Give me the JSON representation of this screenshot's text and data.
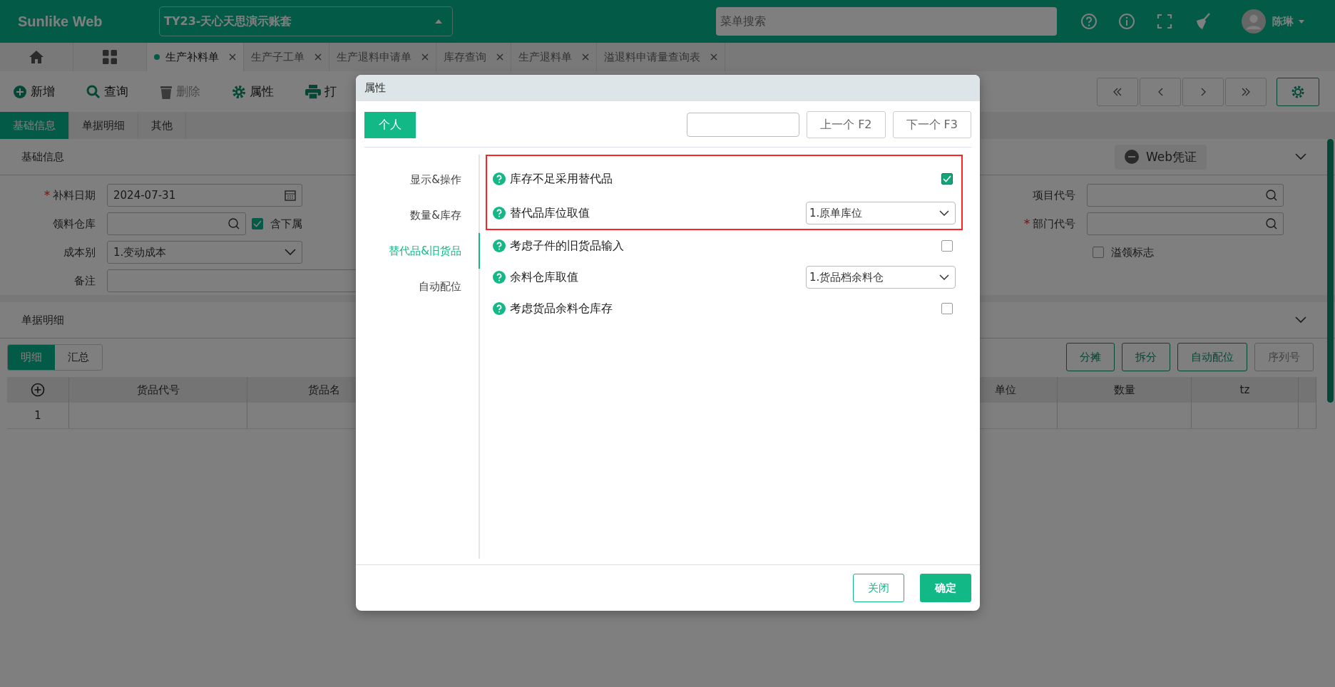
{
  "header": {
    "logo": "Sunlike Web",
    "account": "TY23-天心天思演示账套",
    "search_placeholder": "菜单搜索",
    "user": "陈琳"
  },
  "page_tabs": [
    {
      "label": "生产补料单",
      "selected": true
    },
    {
      "label": "生产子工单",
      "selected": false
    },
    {
      "label": "生产退料申请单",
      "selected": false
    },
    {
      "label": "库存查询",
      "selected": false
    },
    {
      "label": "生产退料单",
      "selected": false
    },
    {
      "label": "溢退料申请量查询表",
      "selected": false
    }
  ],
  "toolbar": [
    {
      "label": "新增",
      "kind": "add",
      "disabled": false
    },
    {
      "label": "查询",
      "kind": "search",
      "disabled": false
    },
    {
      "label": "删除",
      "kind": "delete",
      "disabled": true
    },
    {
      "label": "属性",
      "kind": "settings",
      "disabled": false
    },
    {
      "label": "打",
      "kind": "print",
      "disabled": false
    }
  ],
  "form_tabs": [
    {
      "label": "基础信息",
      "selected": true
    },
    {
      "label": "单据明细",
      "selected": false
    },
    {
      "label": "其他",
      "selected": false
    }
  ],
  "basic_section": {
    "title": "基础信息",
    "voucher_button": "Web凭证"
  },
  "left_fields": [
    {
      "label": "补料日期",
      "required": true,
      "kind": "date",
      "value": "2024-07-31"
    },
    {
      "label": "领料仓库",
      "required": false,
      "kind": "lookup",
      "option": {
        "label": "含下属",
        "checked": true
      }
    },
    {
      "label": "成本别",
      "required": false,
      "kind": "select",
      "value": "1.变动成本"
    },
    {
      "label": "备注",
      "required": false,
      "kind": "text"
    }
  ],
  "right_fields": [
    {
      "label": "项目代号",
      "required": false,
      "kind": "lookup"
    },
    {
      "label": "部门代号",
      "required": true,
      "kind": "lookup"
    }
  ],
  "overflow_flag": {
    "label": "溢领标志",
    "checked": false
  },
  "detail_section": {
    "title": "单据明细"
  },
  "detail_tabs": [
    {
      "label": "明细",
      "selected": true
    },
    {
      "label": "汇总",
      "selected": false
    }
  ],
  "detail_buttons": [
    {
      "label": "分摊",
      "disabled": false
    },
    {
      "label": "拆分",
      "disabled": false
    },
    {
      "label": "自动配位",
      "disabled": false
    },
    {
      "label": "序列号",
      "disabled": true
    }
  ],
  "table": {
    "columns_left": [
      "货品代号",
      "货品名"
    ],
    "columns_right": [
      "单位",
      "数量",
      "tz"
    ],
    "rows": [
      [
        "1"
      ]
    ]
  },
  "modal": {
    "title": "属性",
    "scope_button": "个人",
    "prev_button": "上一个 F2",
    "next_button": "下一个 F3",
    "nav": [
      {
        "label": "显示&操作",
        "selected": false
      },
      {
        "label": "数量&库存",
        "selected": false
      },
      {
        "label": "替代品&旧货品",
        "selected": true
      },
      {
        "label": "自动配位",
        "selected": false
      }
    ],
    "settings": [
      {
        "kind": "checkbox",
        "label": "库存不足采用替代品",
        "checked": true,
        "highlighted": true
      },
      {
        "kind": "select",
        "label": "替代品库位取值",
        "value": "1.原单库位",
        "highlighted": true
      },
      {
        "kind": "checkbox",
        "label": "考虑子件的旧货品输入",
        "checked": false,
        "highlighted": false
      },
      {
        "kind": "select",
        "label": "余料仓库取值",
        "value": "1.货品档余料仓",
        "highlighted": false
      },
      {
        "kind": "checkbox",
        "label": "考虑货品余料仓库存",
        "checked": false,
        "highlighted": false
      }
    ],
    "close_button": "关闭",
    "ok_button": "确定"
  }
}
